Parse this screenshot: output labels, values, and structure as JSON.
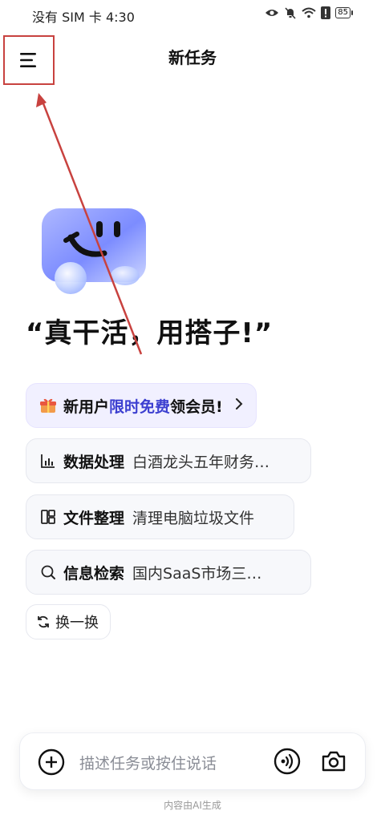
{
  "status_bar": {
    "carrier_time": "没有 SIM 卡 4:30",
    "battery": "85"
  },
  "header": {
    "title": "新任务"
  },
  "hero": {
    "slogan": "“真干活，用搭子!”"
  },
  "promo": {
    "prefix": "新用户",
    "highlight": "限时免费",
    "suffix": "领会员!"
  },
  "suggestions": [
    {
      "category": "数据处理",
      "text": "白酒龙头五年财务…",
      "icon": "chart-icon"
    },
    {
      "category": "文件整理",
      "text": "清理电脑垃圾文件",
      "icon": "layout-icon"
    },
    {
      "category": "信息检索",
      "text": "国内SaaS市场三…",
      "icon": "search-icon"
    }
  ],
  "refresh": {
    "label": "换一换"
  },
  "input": {
    "placeholder": "描述任务或按住说话"
  },
  "footer": {
    "note": "内容由AI生成"
  },
  "colors": {
    "accent": "#3c3fd0",
    "annotation": "#c8423f"
  }
}
